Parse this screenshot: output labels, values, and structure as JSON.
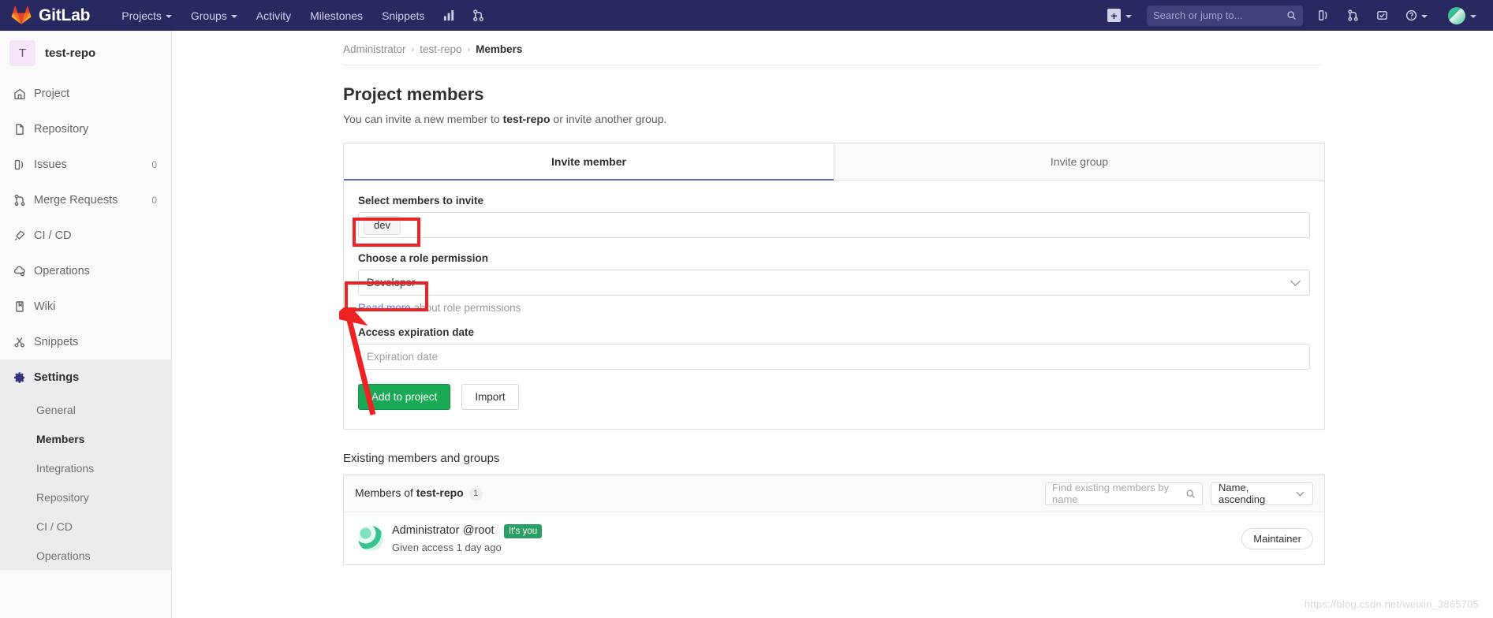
{
  "topnav": {
    "brand": "GitLab",
    "items": [
      {
        "label": "Projects",
        "has_caret": true
      },
      {
        "label": "Groups",
        "has_caret": true
      },
      {
        "label": "Activity",
        "has_caret": false
      },
      {
        "label": "Milestones",
        "has_caret": false
      },
      {
        "label": "Snippets",
        "has_caret": false
      }
    ],
    "icon_buttons": [
      "chart-icon",
      "merge-request-icon"
    ],
    "create_new_label": "+",
    "search_placeholder": "Search or jump to...",
    "right_icons": [
      "issues-icon",
      "merge-requests-icon",
      "todos-icon",
      "help-icon",
      "user-avatar"
    ]
  },
  "sidebar": {
    "project": {
      "initial": "T",
      "name": "test-repo"
    },
    "items": [
      {
        "label": "Project",
        "icon": "home-icon",
        "count": ""
      },
      {
        "label": "Repository",
        "icon": "document-icon",
        "count": ""
      },
      {
        "label": "Issues",
        "icon": "issues-icon",
        "count": "0"
      },
      {
        "label": "Merge Requests",
        "icon": "merge-icon",
        "count": "0"
      },
      {
        "label": "CI / CD",
        "icon": "rocket-icon",
        "count": ""
      },
      {
        "label": "Operations",
        "icon": "cloud-gear-icon",
        "count": ""
      },
      {
        "label": "Wiki",
        "icon": "book-icon",
        "count": ""
      },
      {
        "label": "Snippets",
        "icon": "scissors-icon",
        "count": ""
      },
      {
        "label": "Settings",
        "icon": "gear-icon",
        "count": "",
        "active": true
      }
    ],
    "settings_subitems": [
      {
        "label": "General",
        "active": false
      },
      {
        "label": "Members",
        "active": true
      },
      {
        "label": "Integrations",
        "active": false
      },
      {
        "label": "Repository",
        "active": false
      },
      {
        "label": "CI / CD",
        "active": false
      },
      {
        "label": "Operations",
        "active": false
      }
    ]
  },
  "breadcrumb": {
    "items": [
      "Administrator",
      "test-repo"
    ],
    "current": "Members",
    "separator": "›"
  },
  "page": {
    "title": "Project members",
    "subtitle_pre": "You can invite a new member to ",
    "subtitle_bold": "test-repo",
    "subtitle_post": " or invite another group."
  },
  "invite_panel": {
    "tabs": [
      {
        "label": "Invite member",
        "active": true
      },
      {
        "label": "Invite group",
        "active": false
      }
    ],
    "members_label": "Select members to invite",
    "members_token": "dev",
    "role_label": "Choose a role permission",
    "role_value": "Developer",
    "read_more_link": "Read more",
    "read_more_rest": " about role permissions",
    "expiration_label": "Access expiration date",
    "expiration_placeholder": "Expiration date",
    "add_button": "Add to project",
    "import_button": "Import"
  },
  "existing": {
    "heading": "Existing members and groups",
    "members_of_pre": "Members of ",
    "members_of_bold": "test-repo",
    "count": "1",
    "find_placeholder": "Find existing members by name",
    "sort_value": "Name, ascending",
    "rows": [
      {
        "name": "Administrator",
        "handle": "@root",
        "badge": "It's you",
        "access_text": "Given access 1 day ago",
        "role": "Maintainer"
      }
    ]
  },
  "colors": {
    "nav_bg": "#292961",
    "accent_purple": "#6666c4",
    "green": "#1aaa55",
    "badge_green": "#2a9f63",
    "annotation_red": "#ee2222",
    "link_blue": "#5b72d8"
  },
  "watermark": "https://blog.csdn.net/weixin_3865705"
}
